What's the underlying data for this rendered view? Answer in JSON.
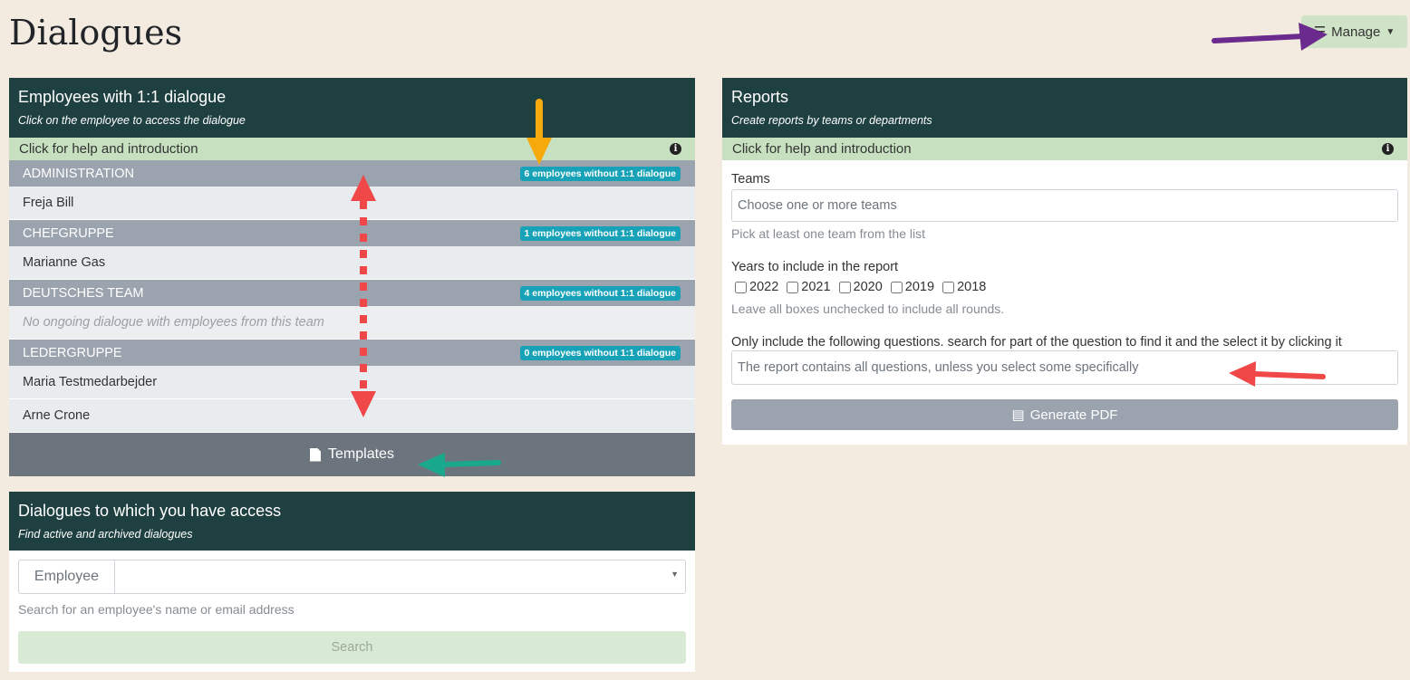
{
  "page_title": "Dialogues",
  "manage_label": "Manage",
  "employees_card": {
    "title": "Employees with 1:1 dialogue",
    "subtitle": "Click on the employee to access the dialogue",
    "help": "Click for help and introduction",
    "teams": [
      {
        "name": "ADMINISTRATION",
        "badge": "6 employees without 1:1 dialogue",
        "employees": [
          "Freja Bill"
        ]
      },
      {
        "name": "CHEFGRUPPE",
        "badge": "1 employees without 1:1 dialogue",
        "employees": [
          "Marianne Gas"
        ]
      },
      {
        "name": "DEUTSCHES TEAM",
        "badge": "4 employees without 1:1 dialogue",
        "empty": "No ongoing dialogue with employees from this team"
      },
      {
        "name": "LEDERGRUPPE",
        "badge": "0 employees without 1:1 dialogue",
        "employees": [
          "Maria Testmedarbejder",
          "Arne Crone"
        ]
      }
    ],
    "templates": "Templates"
  },
  "access_card": {
    "title": "Dialogues to which you have access",
    "subtitle": "Find active and archived dialogues",
    "employee_addon": "Employee",
    "hint": "Search for an employee's name or email address",
    "search_label": "Search"
  },
  "reports_card": {
    "title": "Reports",
    "subtitle": "Create reports by teams or departments",
    "help": "Click for help and introduction",
    "teams_label": "Teams",
    "teams_placeholder": "Choose one or more teams",
    "teams_hint": "Pick at least one team from the list",
    "years_label": "Years to include in the report",
    "years": [
      "2022",
      "2021",
      "2020",
      "2019",
      "2018"
    ],
    "years_hint": "Leave all boxes unchecked to include all rounds.",
    "questions_label": "Only include the following questions. search for part of the question to find it and the select it by clicking it",
    "questions_placeholder": "The report contains all questions, unless you select some specifically",
    "generate_label": "Generate PDF"
  },
  "colors": {
    "header": "#1f4040",
    "help_bar": "#c7e1c0",
    "badge": "#17a2b8",
    "arrow_purple": "#6a2a8e",
    "arrow_orange": "#f5a90a",
    "arrow_red": "#f04848",
    "arrow_green": "#1aa88c"
  }
}
